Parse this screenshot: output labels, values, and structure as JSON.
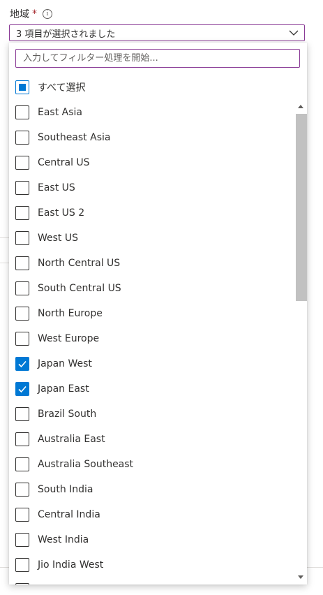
{
  "field": {
    "label": "地域",
    "required_mark": "*",
    "info_glyph": "i"
  },
  "select": {
    "value": "3 項目が選択されました"
  },
  "filter": {
    "placeholder": "入力してフィルター処理を開始..."
  },
  "select_all": {
    "label": "すべて選択",
    "state": "partial"
  },
  "regions": [
    {
      "label": "East Asia",
      "checked": false
    },
    {
      "label": "Southeast Asia",
      "checked": false
    },
    {
      "label": "Central US",
      "checked": false
    },
    {
      "label": "East US",
      "checked": false
    },
    {
      "label": "East US 2",
      "checked": false
    },
    {
      "label": "West US",
      "checked": false
    },
    {
      "label": "North Central US",
      "checked": false
    },
    {
      "label": "South Central US",
      "checked": false
    },
    {
      "label": "North Europe",
      "checked": false
    },
    {
      "label": "West Europe",
      "checked": false
    },
    {
      "label": "Japan West",
      "checked": true
    },
    {
      "label": "Japan East",
      "checked": true
    },
    {
      "label": "Brazil South",
      "checked": false
    },
    {
      "label": "Australia East",
      "checked": false
    },
    {
      "label": "Australia Southeast",
      "checked": false
    },
    {
      "label": "South India",
      "checked": false
    },
    {
      "label": "Central India",
      "checked": false
    },
    {
      "label": "West India",
      "checked": false
    },
    {
      "label": "Jio India West",
      "checked": false
    },
    {
      "label": "",
      "checked": false
    }
  ],
  "colors": {
    "accent": "#0078d4",
    "focus_border": "#8a3b96",
    "required": "#a4262c",
    "scroll_thumb": "#c1c1c1"
  },
  "icons": {
    "info": "info-icon",
    "dropdown": "chevron-down-icon",
    "check": "checkmark-icon",
    "scroll_up": "scroll-up-arrow-icon",
    "scroll_down": "scroll-down-arrow-icon"
  }
}
